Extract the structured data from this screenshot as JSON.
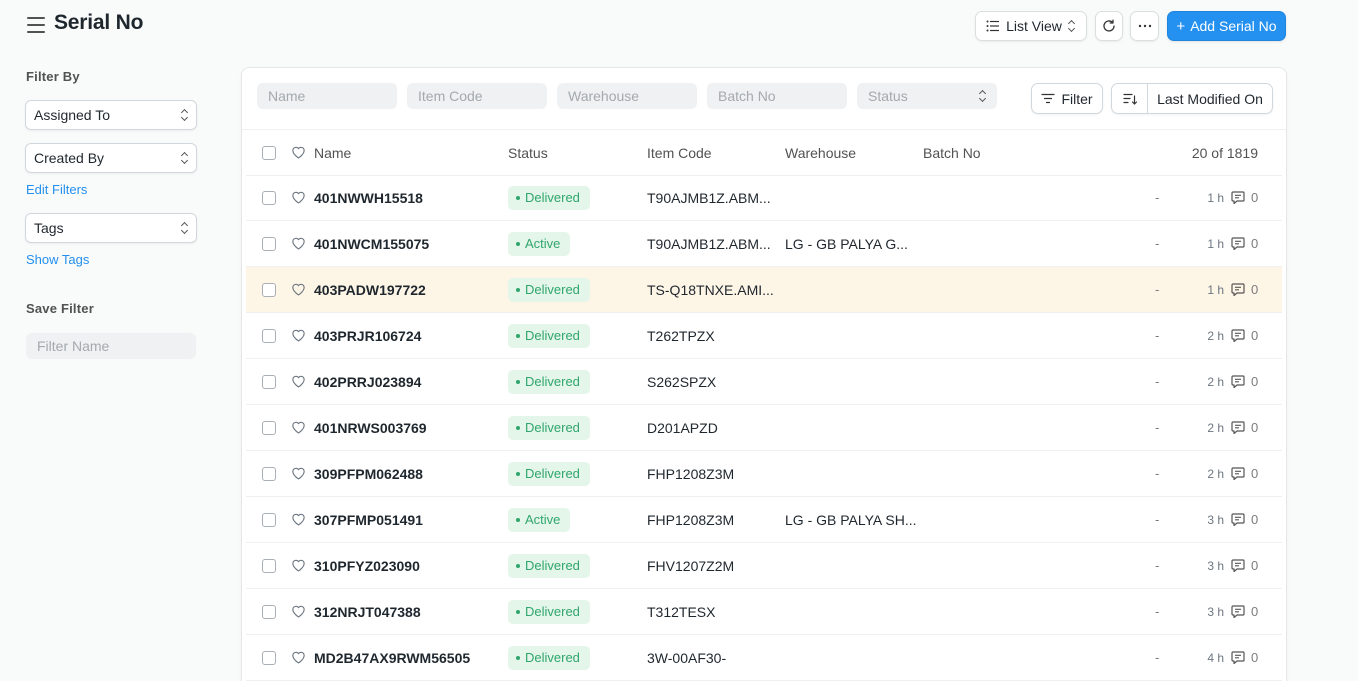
{
  "header": {
    "title": "Serial No",
    "list_view_label": "List View",
    "add_button_label": "Add Serial No"
  },
  "sidebar": {
    "filter_by_heading": "Filter By",
    "assigned_to": "Assigned To",
    "created_by": "Created By",
    "edit_filters": "Edit Filters",
    "tags": "Tags",
    "show_tags": "Show Tags",
    "save_filter_heading": "Save Filter",
    "filter_name_placeholder": "Filter Name"
  },
  "filters": {
    "name_placeholder": "Name",
    "item_code_placeholder": "Item Code",
    "warehouse_placeholder": "Warehouse",
    "batch_no_placeholder": "Batch No",
    "status_placeholder": "Status",
    "filter_button": "Filter",
    "sort_field": "Last Modified On"
  },
  "list": {
    "columns": {
      "name": "Name",
      "status": "Status",
      "item_code": "Item Code",
      "warehouse": "Warehouse",
      "batch_no": "Batch No"
    },
    "count": "20 of 1819",
    "rows": [
      {
        "name": "401NWWH15518",
        "status": "Delivered",
        "item_code": "T90AJMB1Z.ABM...",
        "warehouse": "",
        "dash": "-",
        "time": "1 h",
        "comments": "0"
      },
      {
        "name": "401NWCM155075",
        "status": "Active",
        "item_code": "T90AJMB1Z.ABM...",
        "warehouse": "LG - GB PALYA G...",
        "dash": "-",
        "time": "1 h",
        "comments": "0"
      },
      {
        "name": "403PADW197722",
        "status": "Delivered",
        "item_code": "TS-Q18TNXE.AMI...",
        "warehouse": "",
        "dash": "-",
        "time": "1 h",
        "comments": "0"
      },
      {
        "name": "403PRJR106724",
        "status": "Delivered",
        "item_code": "T262TPZX",
        "warehouse": "",
        "dash": "-",
        "time": "2 h",
        "comments": "0"
      },
      {
        "name": "402PRRJ023894",
        "status": "Delivered",
        "item_code": "S262SPZX",
        "warehouse": "",
        "dash": "-",
        "time": "2 h",
        "comments": "0"
      },
      {
        "name": "401NRWS003769",
        "status": "Delivered",
        "item_code": "D201APZD",
        "warehouse": "",
        "dash": "-",
        "time": "2 h",
        "comments": "0"
      },
      {
        "name": "309PFPM062488",
        "status": "Delivered",
        "item_code": "FHP1208Z3M",
        "warehouse": "",
        "dash": "-",
        "time": "2 h",
        "comments": "0"
      },
      {
        "name": "307PFMP051491",
        "status": "Active",
        "item_code": "FHP1208Z3M",
        "warehouse": "LG - GB PALYA SH...",
        "dash": "-",
        "time": "3 h",
        "comments": "0"
      },
      {
        "name": "310PFYZ023090",
        "status": "Delivered",
        "item_code": "FHV1207Z2M",
        "warehouse": "",
        "dash": "-",
        "time": "3 h",
        "comments": "0"
      },
      {
        "name": "312NRJT047388",
        "status": "Delivered",
        "item_code": "T312TESX",
        "warehouse": "",
        "dash": "-",
        "time": "3 h",
        "comments": "0"
      },
      {
        "name": "MD2B47AX9RWM56505",
        "status": "Delivered",
        "item_code": "3W-00AF30-",
        "warehouse": "",
        "dash": "-",
        "time": "4 h",
        "comments": "0"
      }
    ]
  }
}
